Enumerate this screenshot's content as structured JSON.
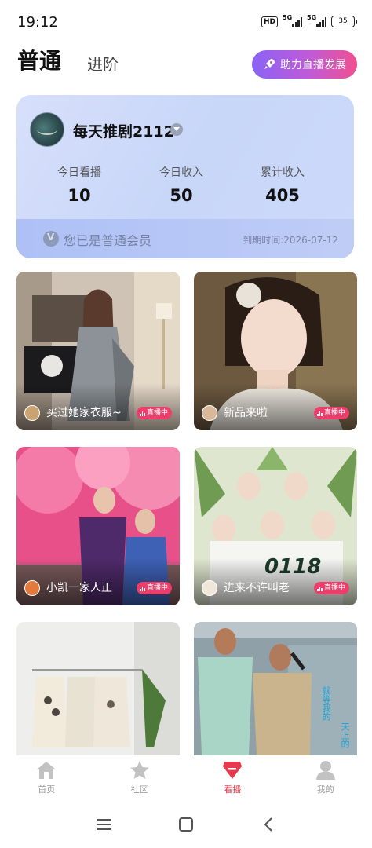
{
  "status_bar": {
    "time": "19:12",
    "hd_label": "HD",
    "network_1": "5G",
    "network_2": "5G",
    "battery": "35"
  },
  "header": {
    "tab_normal": "普通",
    "tab_advanced": "进阶",
    "boost_button": "助力直播发展"
  },
  "member_card": {
    "username": "每天推剧2112",
    "stats": [
      {
        "label": "今日看播",
        "value": "10"
      },
      {
        "label": "今日收入",
        "value": "50"
      },
      {
        "label": "累计收入",
        "value": "405"
      }
    ],
    "member_status": "您已是普通会员",
    "expiry": "到期时间:2026-07-12"
  },
  "feed": [
    {
      "title": "买过她家衣服~",
      "live_label": "直播中"
    },
    {
      "title": "新品来啦",
      "live_label": "直播中"
    },
    {
      "title": "小凯一家人正",
      "live_label": "直播中"
    },
    {
      "title": "进来不许叫老",
      "live_label": "直播中"
    },
    {
      "title": "",
      "live_label": ""
    },
    {
      "title": "",
      "live_label": ""
    }
  ],
  "feed_overlay_texts": {
    "group_number": "0118",
    "poster_text_1": "就等我的",
    "poster_text_2": "天上的"
  },
  "bottom_nav": [
    {
      "label": "首页",
      "icon": "home-icon",
      "active": false
    },
    {
      "label": "社区",
      "icon": "star-icon",
      "active": false
    },
    {
      "label": "看播",
      "icon": "live-watch-icon",
      "active": true
    },
    {
      "label": "我的",
      "icon": "profile-icon",
      "active": false
    }
  ],
  "colors": {
    "accent": "#e83a4d",
    "live_badge": "#ec3d6b",
    "boost_gradient_start": "#8a63f5",
    "boost_gradient_end": "#f0508f"
  }
}
